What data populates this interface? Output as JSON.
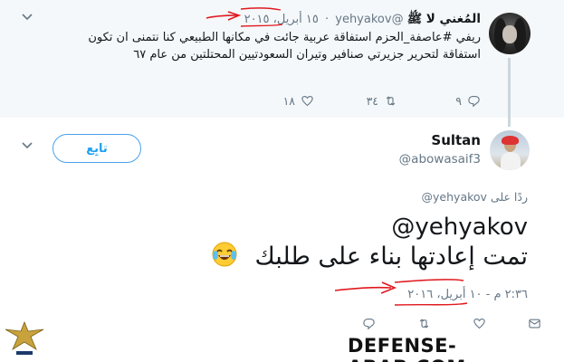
{
  "parent_tweet": {
    "name": "المُغني لا ﷺ",
    "handle": "@yehyakov",
    "date": "١٥ أبريل، ٢٠١٥",
    "text": "ريفي #عاصفة_الحزم استفاقة عربية جائت في مكانها الطبيعي كنا نتمنى ان تكون استفاقة لتحرير جزيرتي صنافير وتيران السعودتيين المحتلتين من عام ٦٧",
    "actions": {
      "reply": "٩",
      "retweet": "٣٤",
      "like": "١٨"
    }
  },
  "main_tweet": {
    "name": "Sultan",
    "handle": "@abowasaif3",
    "follow_label": "تابِع",
    "reply_prefix": "ردًا على",
    "reply_handle": "@yehyakov",
    "mention": "@yehyakov",
    "text": "تمت إعادتها بناء على طلبك",
    "emoji": "😂",
    "timestamp": "٢:٣٦ م - ١٠ أبريل، ٢٠١٦"
  },
  "watermark": {
    "text": "DEFENSE-ARAB.COM"
  },
  "icons": {
    "chevron": "chevron-down-icon",
    "reply": "reply-icon",
    "retweet": "retweet-icon",
    "like": "heart-icon",
    "message": "message-icon"
  },
  "colors": {
    "accent": "#1da1f2",
    "muted": "#657786",
    "annotation": "#e0191e"
  }
}
